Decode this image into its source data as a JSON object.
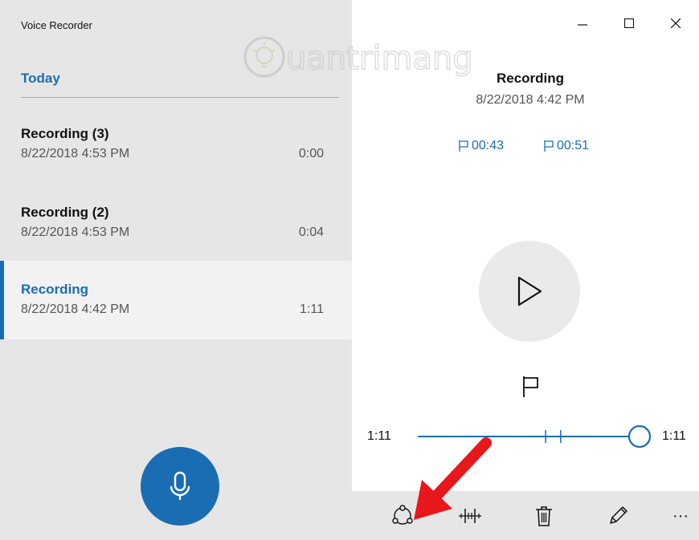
{
  "app": {
    "title": "Voice Recorder"
  },
  "list": {
    "section_header": "Today",
    "items": [
      {
        "name": "Recording (3)",
        "date": "8/22/2018 4:53 PM",
        "duration": "0:00",
        "selected": false
      },
      {
        "name": "Recording (2)",
        "date": "8/22/2018 4:53 PM",
        "duration": "0:04",
        "selected": false
      },
      {
        "name": "Recording",
        "date": "8/22/2018 4:42 PM",
        "duration": "1:11",
        "selected": true
      }
    ]
  },
  "detail": {
    "title": "Recording",
    "date": "8/22/2018 4:42 PM",
    "markers": [
      "00:43",
      "00:51"
    ],
    "position_label": "1:11",
    "length_label": "1:11",
    "progress": 1.0,
    "marker_fractions": [
      0.605,
      0.676
    ]
  },
  "watermark": {
    "text": "uantrimang"
  },
  "colors": {
    "accent": "#1a6db3",
    "pane": "#e6e6e6",
    "selected_row": "#f2f2f2",
    "annotation_arrow": "#e8171b"
  },
  "icons": {
    "window_minimize": "minimize-icon",
    "window_maximize": "maximize-icon",
    "window_close": "close-icon",
    "record": "microphone-icon",
    "play": "play-icon",
    "add_marker": "flag-icon",
    "share": "share-icon",
    "trim": "trim-icon",
    "delete": "trash-icon",
    "rename": "pencil-icon",
    "more": "more-icon"
  },
  "toolbar": {
    "more_label": "···"
  }
}
